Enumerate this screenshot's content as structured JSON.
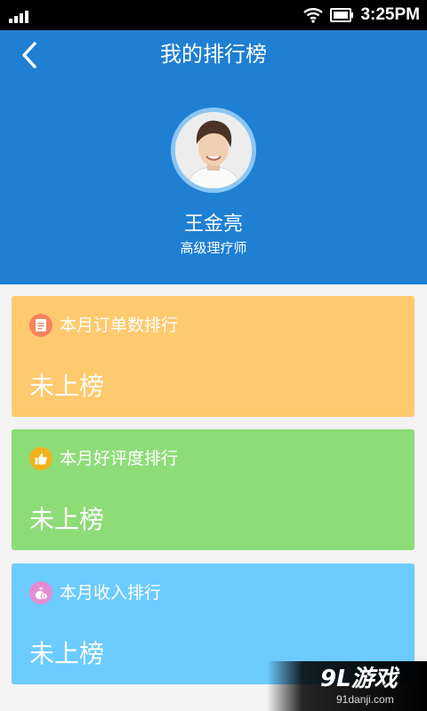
{
  "status_bar": {
    "time": "3:25PM"
  },
  "header": {
    "title": "我的排行榜"
  },
  "user": {
    "name": "王金亮",
    "title": "高级理疗师"
  },
  "cards": [
    {
      "icon": "document-icon",
      "title": "本月订单数排行",
      "value": "未上榜",
      "icon_color": "#f4845f"
    },
    {
      "icon": "thumbs-up-icon",
      "title": "本月好评度排行",
      "value": "未上榜",
      "icon_color": "#f3b21c"
    },
    {
      "icon": "money-bag-icon",
      "title": "本月收入排行",
      "value": "未上榜",
      "icon_color": "#e58cd2"
    }
  ],
  "watermark": {
    "logo": "9L游戏",
    "site": "91danji.com"
  },
  "colors": {
    "header": "#1e7fd3",
    "orders_card": "#ffc96e",
    "rating_card": "#8ddc78",
    "income_card": "#6ccbff"
  }
}
